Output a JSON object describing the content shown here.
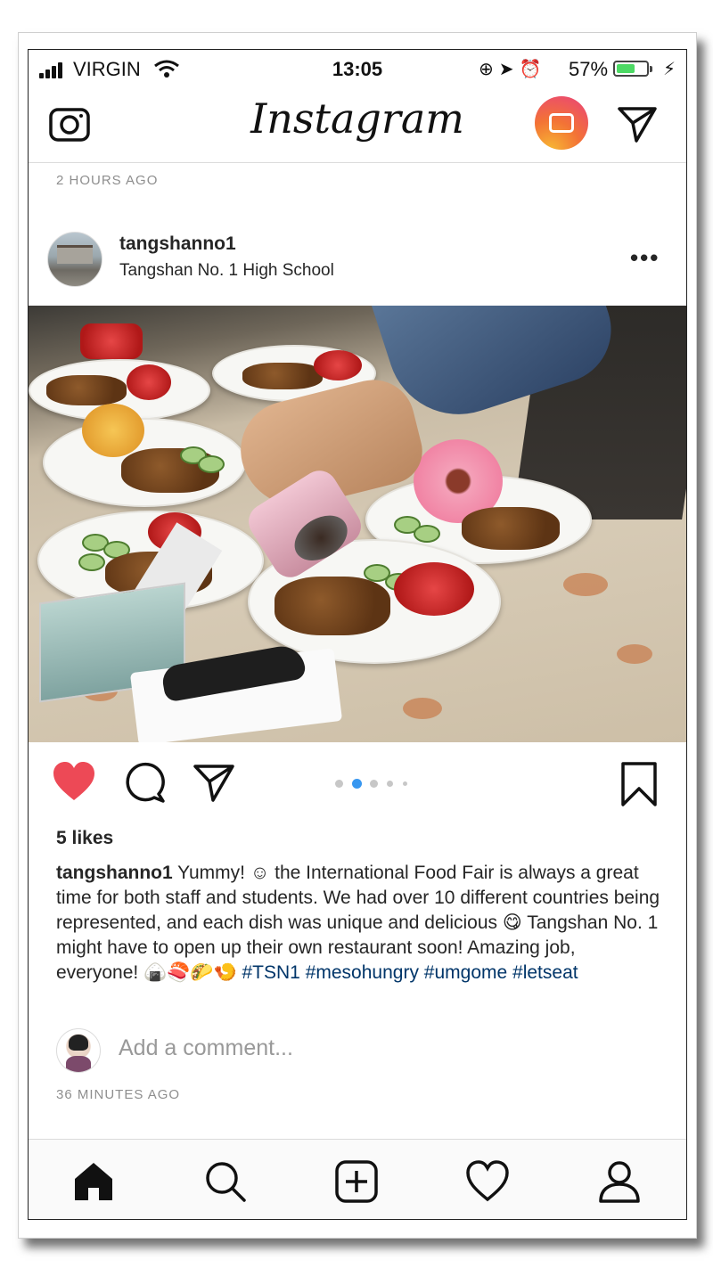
{
  "status_bar": {
    "carrier": "VIRGIN",
    "time": "13:05",
    "battery_percent": "57%",
    "battery_level": 0.57,
    "icons": [
      "signal-icon",
      "wifi-icon",
      "rotation-lock-icon",
      "location-icon",
      "alarm-icon",
      "battery-icon",
      "charging-icon"
    ]
  },
  "header": {
    "logo": "Instagram",
    "icons": [
      "camera-icon",
      "igtv-icon",
      "direct-message-icon"
    ]
  },
  "feed": {
    "previous_post_time": "2 HOURS AGO"
  },
  "post": {
    "username": "tangshanno1",
    "location": "Tangshan No. 1 High School",
    "more_label": "•••",
    "image_alt": "International food fair plates on a table",
    "carousel": {
      "count": 5,
      "active_index": 1
    },
    "likes": "5 likes",
    "caption": {
      "username": "tangshanno1",
      "line1": " Yummy! ",
      "emoji1": "☺",
      "line2": " the International Food Fair is always a great time for both staff and students. We had over 10 different countries being represented, and each dish was unique and delicious ",
      "emoji2": "😋",
      "line3": " Tangshan No. 1 might have to open up their own restaurant soon! Amazing job, everyone! ",
      "emoji3": "🍙🍣🌮🍤",
      "hashtags": [
        "#TSN1",
        "#mesohungry",
        "#umgome",
        "#letseat"
      ]
    },
    "comment_placeholder": "Add a comment...",
    "time": "36 MINUTES AGO",
    "liked": true
  },
  "tab_bar": {
    "items": [
      "home-icon",
      "search-icon",
      "new-post-icon",
      "activity-icon",
      "profile-icon"
    ]
  },
  "colors": {
    "like_red": "#ed4956",
    "hashtag_blue": "#003569",
    "carousel_active": "#3897f0",
    "secondary_text": "#8e8e8e"
  }
}
